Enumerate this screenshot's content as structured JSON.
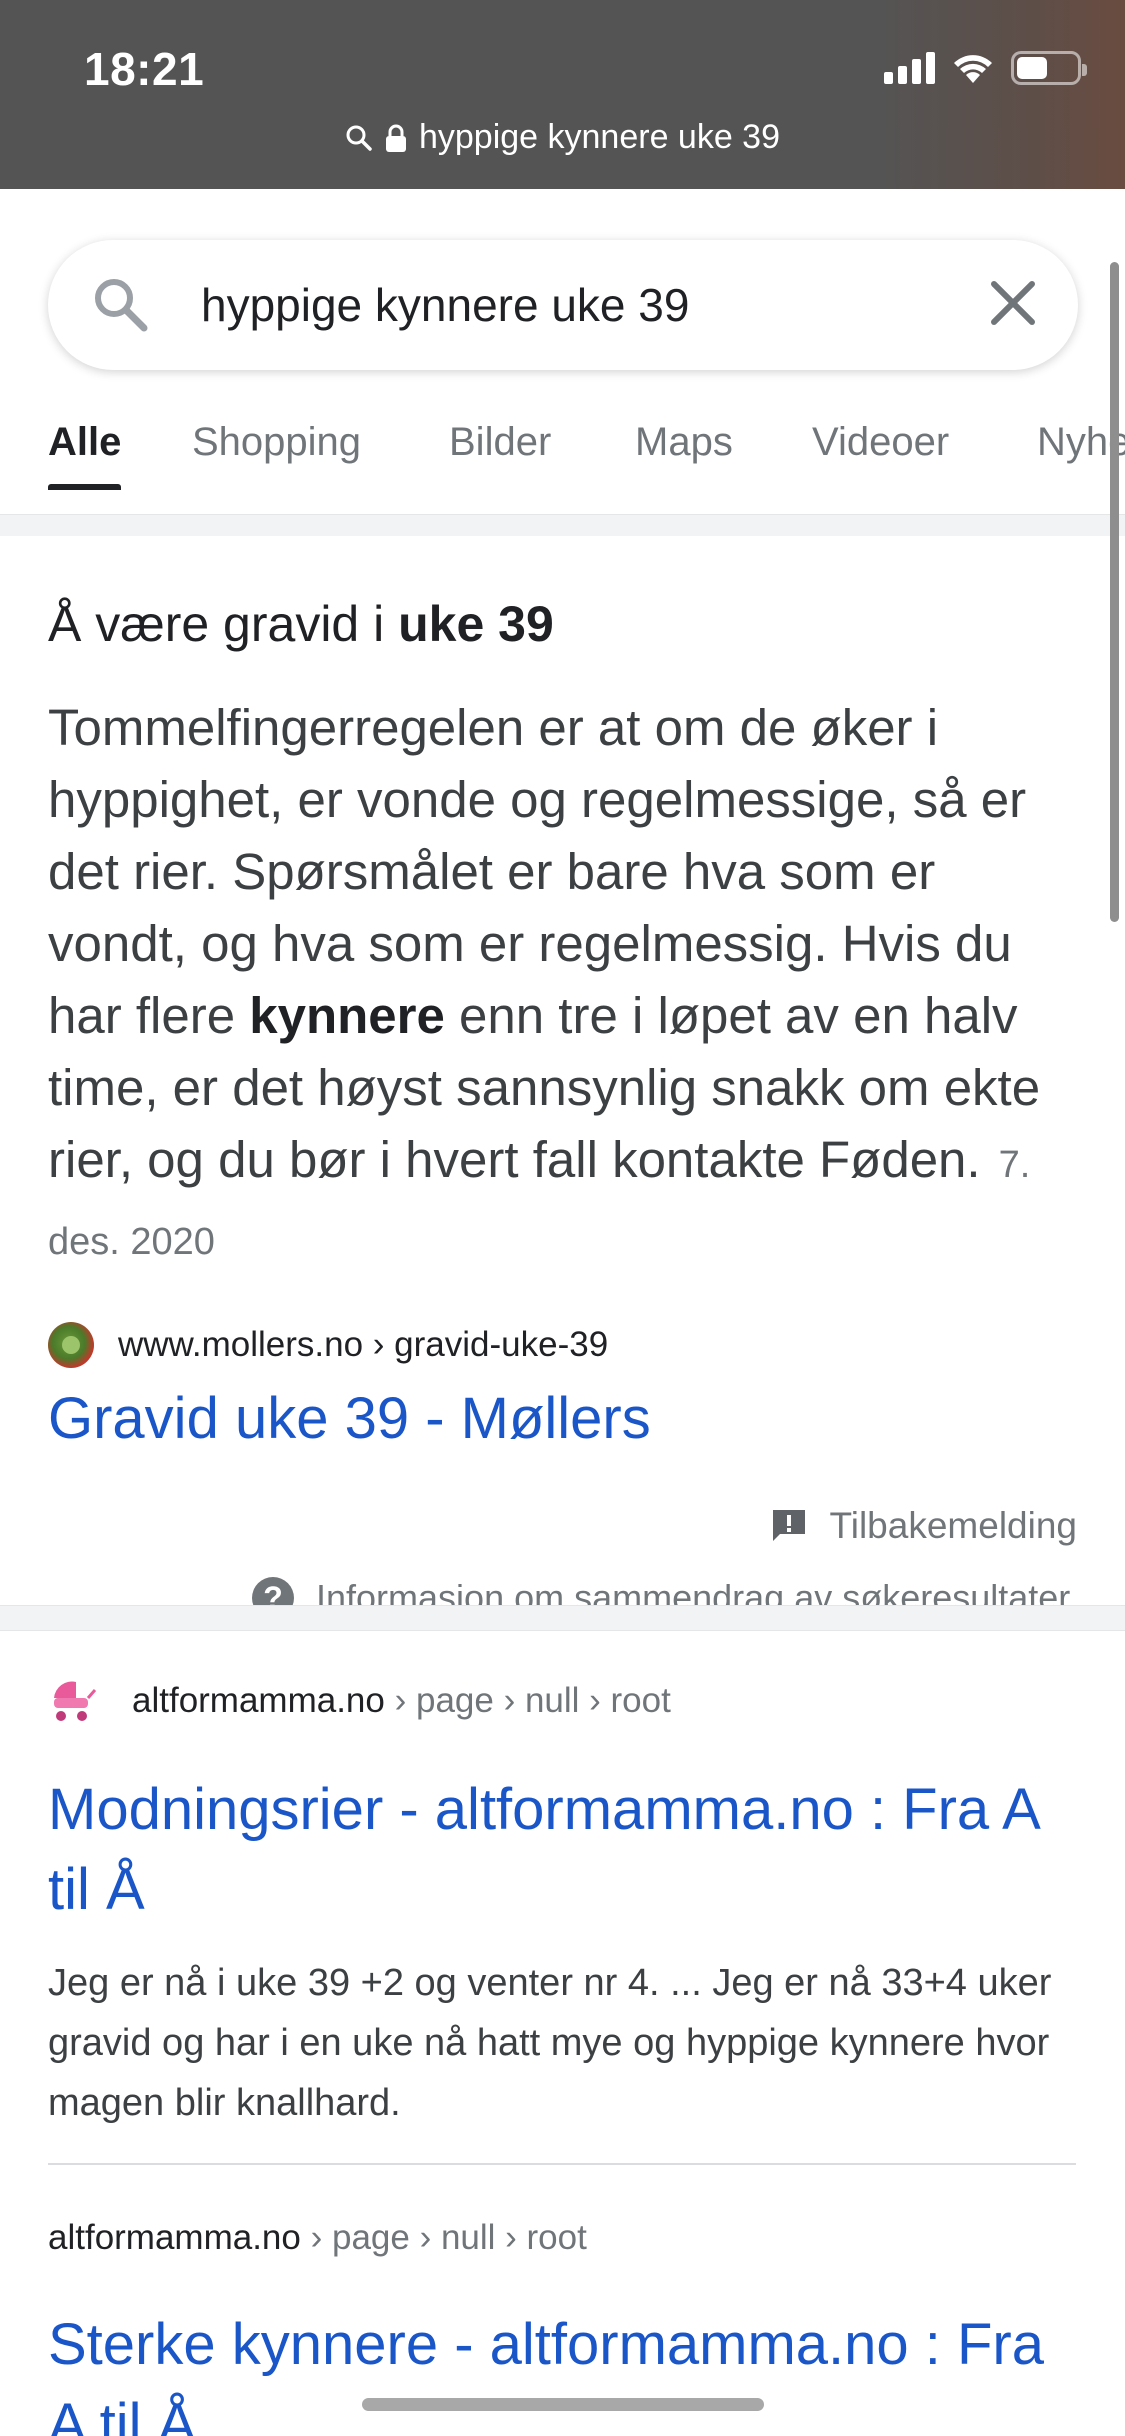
{
  "status_bar": {
    "time": "18:21",
    "icons": [
      "signal-icon",
      "wifi-icon",
      "battery-icon"
    ]
  },
  "address_bar": {
    "url_text": "hyppige kynnere uke 39",
    "icons": [
      "search-icon",
      "lock-icon"
    ]
  },
  "search": {
    "query": "hyppige kynnere uke 39",
    "icons": [
      "search-icon",
      "clear-icon"
    ]
  },
  "tabs": [
    {
      "label": "Alle",
      "active": true
    },
    {
      "label": "Shopping",
      "active": false
    },
    {
      "label": "Bilder",
      "active": false
    },
    {
      "label": "Maps",
      "active": false
    },
    {
      "label": "Videoer",
      "active": false
    },
    {
      "label": "Nyheter",
      "active": false
    }
  ],
  "featured_snippet": {
    "title_prefix": "Å være gravid i ",
    "title_bold": "uke 39",
    "body_part1": "Tommelfingerregelen er at om de øker i hyppighet, er vonde og regelmessige, så er det rier. Spørsmålet er bare hva som er vondt, og hva som er regelmessig. Hvis du har flere ",
    "body_bold": "kynnere",
    "body_part2": " enn tre i løpet av en halv time, er det høyst sannsynlig snakk om ekte rier, og du bør i hvert fall kontakte Føden.",
    "date": "7. des. 2020",
    "cite": "www.mollers.no › gravid-uke-39",
    "link_title": "Gravid uke 39 - Møllers",
    "feedback_label": "Tilbakemelding",
    "info_label": "Informasjon om sammendrag av søkeresultater"
  },
  "results": [
    {
      "domain": "altformamma.no",
      "path": " › page › null › root",
      "title": "Modningsrier - altformamma.no : Fra A til Å",
      "description": "Jeg er nå i uke 39 +2 og venter nr 4. ... Jeg er nå 33+4 uker gravid og har i en uke nå hatt mye og hyppige kynnere hvor magen blir knallhard."
    },
    {
      "domain": "altformamma.no",
      "path": " › page › null › root",
      "title": "Sterke kynnere - altformamma.no : Fra A til Å"
    }
  ],
  "colors": {
    "link": "#1a56c8",
    "chrome": "#545454",
    "muted": "#70757a"
  }
}
